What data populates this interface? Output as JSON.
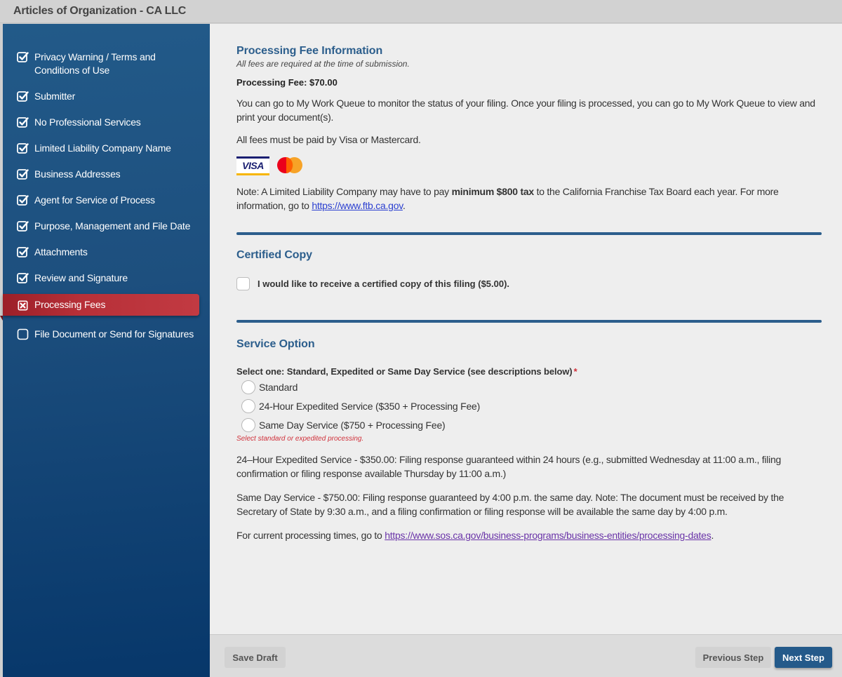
{
  "window": {
    "title": "Articles of Organization - CA LLC"
  },
  "sidebar": {
    "items": [
      {
        "label": "Privacy Warning / Terms and Conditions of Use",
        "status": "complete",
        "icon": "checkbox-checked-icon"
      },
      {
        "label": "Submitter",
        "status": "complete",
        "icon": "checkbox-checked-icon"
      },
      {
        "label": "No Professional Services",
        "status": "complete",
        "icon": "checkbox-checked-icon"
      },
      {
        "label": "Limited Liability Company Name",
        "status": "complete",
        "icon": "checkbox-checked-icon"
      },
      {
        "label": "Business Addresses",
        "status": "complete",
        "icon": "checkbox-checked-icon"
      },
      {
        "label": "Agent for Service of Process",
        "status": "complete",
        "icon": "checkbox-checked-icon"
      },
      {
        "label": "Purpose, Management and File Date",
        "status": "complete",
        "icon": "checkbox-checked-icon"
      },
      {
        "label": "Attachments",
        "status": "complete",
        "icon": "checkbox-checked-icon"
      },
      {
        "label": "Review and Signature",
        "status": "complete",
        "icon": "checkbox-checked-icon"
      },
      {
        "label": "Processing Fees",
        "status": "error-active",
        "icon": "checkbox-x-icon"
      },
      {
        "label": "File Document or Send for Signatures",
        "status": "incomplete",
        "icon": "checkbox-empty-icon"
      }
    ],
    "active_color": "#b73038",
    "bg_color": "#1d4f7e"
  },
  "fee_info": {
    "heading": "Processing Fee Information",
    "subheading": "All fees are required at the time of submission.",
    "fee_label": "Processing Fee: $70.00",
    "queue_text": "You can go to My Work Queue to monitor the status of your filing. Once your filing is processed, you can go to My Work Queue to view and print your document(s).",
    "payment_text": "All fees must be paid by Visa or Mastercard.",
    "cards": {
      "visa_label": "VISA",
      "visa_icon": "visa-logo-icon",
      "mastercard_icon": "mastercard-logo-icon"
    },
    "note_prefix": "Note: A Limited Liability Company may have to pay ",
    "note_bold": "minimum $800 tax",
    "note_suffix": " to the California Franchise Tax Board each year. For more information, go to ",
    "note_link": "https://www.ftb.ca.gov",
    "note_end": "."
  },
  "certified_copy": {
    "heading": "Certified Copy",
    "checkbox_label": "I would like to receive a certified copy of this filing ($5.00).",
    "checked": false
  },
  "service_option": {
    "heading": "Service Option",
    "question": "Select one: Standard, Expedited or Same Day Service (see descriptions below)",
    "required_mark": "*",
    "options": [
      {
        "label": "Standard",
        "selected": false
      },
      {
        "label": "24-Hour Expedited Service ($350 + Processing Fee)",
        "selected": false
      },
      {
        "label": "Same Day Service ($750 + Processing Fee)",
        "selected": false
      }
    ],
    "error": "Select standard or expedited processing.",
    "expedited_desc": "24–Hour Expedited Service - $350.00: Filing response guaranteed within 24 hours (e.g., submitted Wednesday at 11:00 a.m., filing confirmation or filing response available Thursday by 11:00 a.m.)",
    "sameday_desc": "Same Day Service - $750.00: Filing response guaranteed by 4:00 p.m. the same day. Note: The document must be received by the Secretary of State by 9:30 a.m., and a filing confirmation or filing response will be available the same day by 4:00 p.m.",
    "times_prefix": "For current processing times, go to ",
    "times_link": "https://www.sos.ca.gov/business-programs/business-entities/processing-dates",
    "times_end": "."
  },
  "footer": {
    "save_draft": "Save Draft",
    "previous_step": "Previous Step",
    "next_step": "Next Step"
  },
  "colors": {
    "heading": "#2c5e8c",
    "primary_button": "#245a8a",
    "error": "#d0303a"
  }
}
